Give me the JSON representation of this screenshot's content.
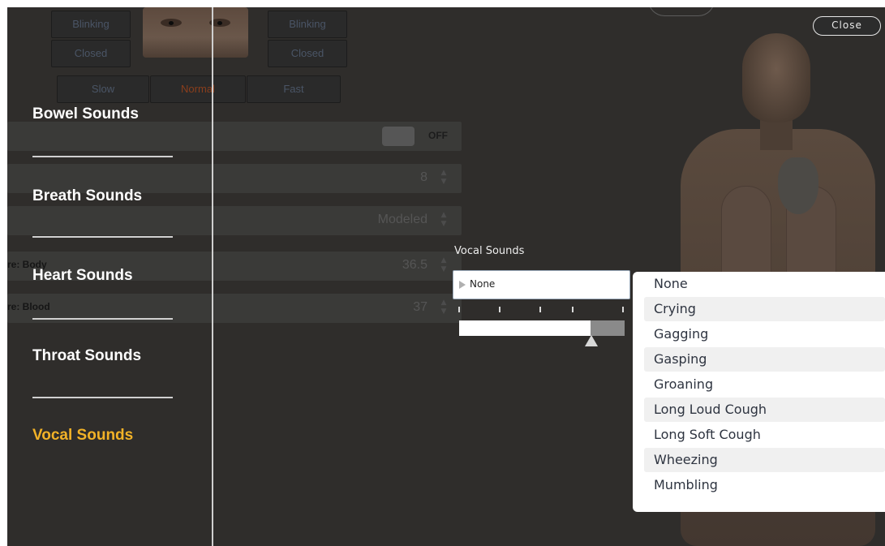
{
  "background_panel": {
    "eye_buttons_left": [
      "Blinking",
      "Closed"
    ],
    "eye_buttons_right": [
      "Blinking",
      "Closed"
    ],
    "speed_buttons": [
      "Slow",
      "Normal",
      "Fast"
    ],
    "active_speed": "Normal",
    "rows": [
      {
        "label": "",
        "value": "",
        "toggle_label": "OFF"
      },
      {
        "label": "",
        "value": "8"
      },
      {
        "label": "",
        "value": "Modeled"
      },
      {
        "label": "re: Body",
        "value": "36.5"
      },
      {
        "label": "re: Blood",
        "value": "37"
      }
    ]
  },
  "categories": [
    {
      "label": "Bowel Sounds",
      "active": false
    },
    {
      "label": "Breath Sounds",
      "active": false
    },
    {
      "label": "Heart Sounds",
      "active": false
    },
    {
      "label": "Throat Sounds",
      "active": false
    },
    {
      "label": "Vocal Sounds",
      "active": true
    }
  ],
  "close_label": "Close",
  "vocal_sounds": {
    "title": "Vocal Sounds",
    "selected": "None",
    "volume_level": 0.79,
    "options": [
      "None",
      "Crying",
      "Gagging",
      "Gasping",
      "Groaning",
      "Long Loud Cough",
      "Long Soft Cough",
      "Wheezing",
      "Mumbling"
    ]
  },
  "colors": {
    "active_category": "#f2b227",
    "inactive_category": "#ffffff",
    "overlay": "#2f2d2b",
    "dropdown_bg": "#ffffff"
  }
}
